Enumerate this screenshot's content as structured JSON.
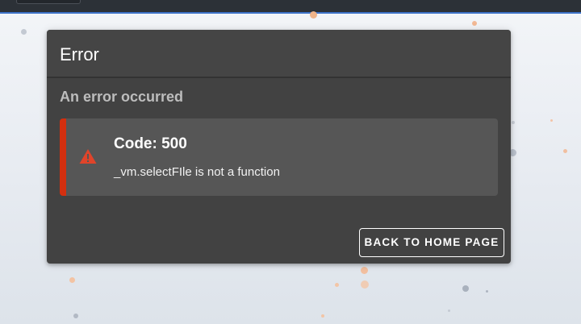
{
  "card": {
    "title": "Error",
    "subtitle": "An error occurred"
  },
  "alert": {
    "icon": "warning-triangle-icon",
    "code": "Code: 500",
    "message": "_vm.selectFIle is not a function",
    "accent_color": "#d32f0f"
  },
  "actions": {
    "back_home_label": "BACK TO HOME PAGE"
  },
  "theme": {
    "card_background": "#424242",
    "alert_background": "#565656",
    "topbar_accent": "#3d73c9"
  }
}
